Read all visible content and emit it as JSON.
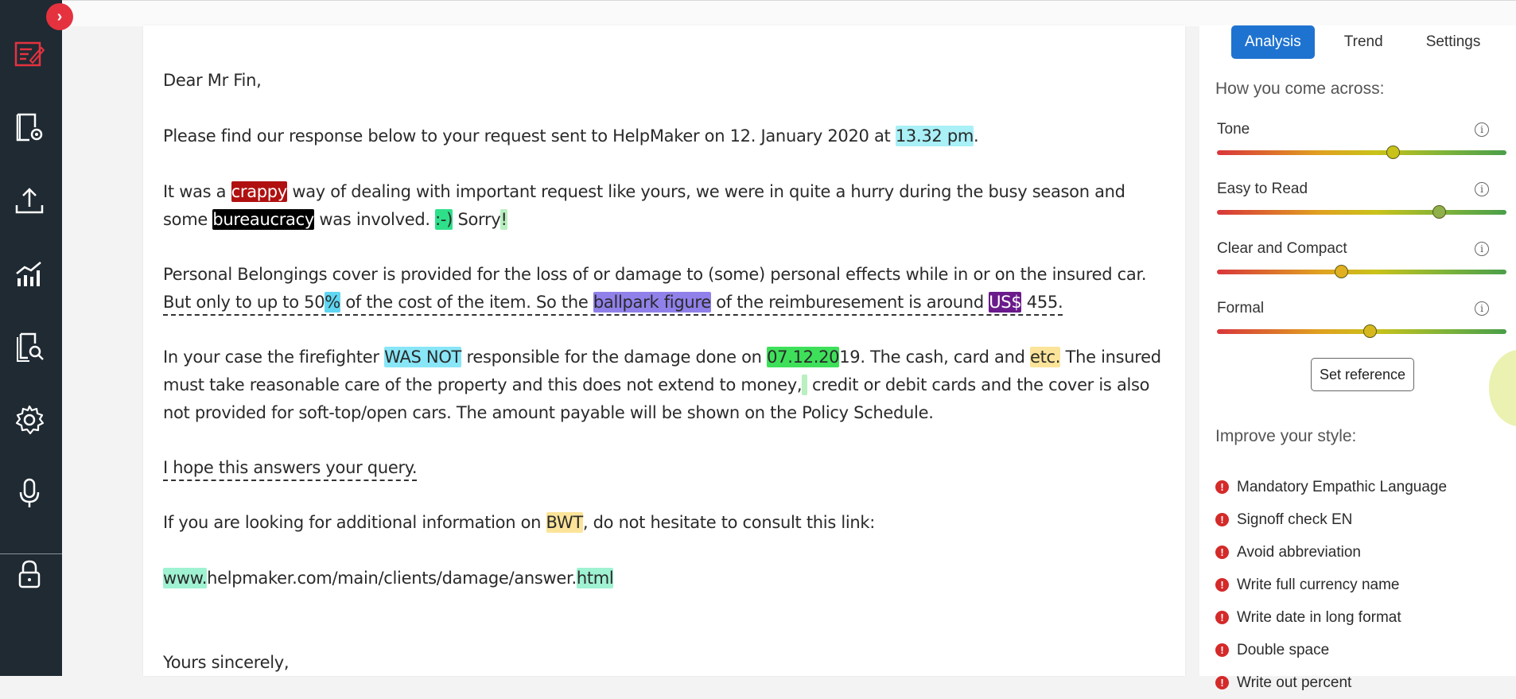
{
  "colors": {
    "rail_bg": "#1f2a33",
    "accent_red": "#e5323f",
    "tab_active": "#1f73d0",
    "hl_cyan": "#a9f0f7",
    "hl_darkred": "#b01010",
    "hl_black": "#000000",
    "hl_mint": "#2ee08a",
    "hl_lightgreen": "#b9f0c0",
    "hl_blue": "#5fd6f2",
    "hl_purple": "#9080ea",
    "hl_darkpurple": "#6a1a8a",
    "hl_skyblue": "#88e6f7",
    "hl_green": "#3ee05a",
    "hl_yellow": "#fbe49a",
    "hl_aqua": "#9ff2d2"
  },
  "nav": [
    {
      "name": "editor-icon"
    },
    {
      "name": "document-settings-icon"
    },
    {
      "name": "upload-icon"
    },
    {
      "name": "analytics-icon"
    },
    {
      "name": "document-search-icon"
    },
    {
      "name": "settings-gear-icon"
    },
    {
      "name": "microphone-icon"
    },
    {
      "name": "lock-icon"
    }
  ],
  "collapse": {
    "glyph": "›"
  },
  "letter": {
    "greeting": "Dear Mr Fin,",
    "p1": {
      "a": "Please find our response below to your request sent to HelpMaker on 12. January 2020 at ",
      "hl": "13.32 pm",
      "b": "."
    },
    "p2": {
      "a": "It was a ",
      "h1": "crappy",
      "b": " way of dealing with important request like yours, we were in quite a hurry during the busy season and some ",
      "h2": "bureaucracy",
      "c": " was involved. ",
      "h3": ":-)",
      "d": " Sorry",
      "h4": "!"
    },
    "p3": {
      "a": "Personal Belongings cover is provided for the loss of or damage to (some) personal effects while in or on the insured car. ",
      "u1": "But only to up to 50",
      "h1": "%",
      "u2": " of the cost of the item. So the ",
      "h2": "ballpark figure",
      "u3": " of the reimburesement is around ",
      "h3": "US$",
      "u4": " 455."
    },
    "p4": {
      "a": "In your case the firefighter ",
      "h1": "WAS NOT",
      "b": " responsible for the damage done on ",
      "h2": "07.12.20",
      "c": "19. The cash, card and ",
      "h3": "etc.",
      "d": " The insured must take reasonable care of the property and this does not extend to money,",
      "h4": " ",
      "e": " credit or debit cards and the cover is also not provided for soft-top/open cars. The amount payable will be shown on the Policy Schedule."
    },
    "p5": "I hope this answers your query.",
    "p6": {
      "a": "If you are looking for additional information on ",
      "hl": "BWT",
      "b": ", do not hesitate to consult this link:"
    },
    "p7": {
      "h1": "www.",
      "a": "helpmaker.com/main/clients/damage/answer.",
      "h2": "html"
    },
    "closing": "Yours sincerely,"
  },
  "panel": {
    "tabs": [
      "Analysis",
      "Trend",
      "Settings"
    ],
    "heading1": "How you come across:",
    "metrics": [
      {
        "label": "Tone",
        "level": 0.61,
        "knob_color": "#c9c21a"
      },
      {
        "label": "Easy to Read",
        "level": 0.77,
        "knob_color": "#8fb04a"
      },
      {
        "label": "Clear and Compact",
        "level": 0.43,
        "knob_color": "#e0b020"
      },
      {
        "label": "Formal",
        "level": 0.53,
        "knob_color": "#d6b81e"
      }
    ],
    "info_glyph": "i",
    "set_reference": "Set reference",
    "heading2": "Improve your style:",
    "issues": [
      "Mandatory Empathic Language",
      "Signoff check EN",
      "Avoid abbreviation",
      "Write full currency name",
      "Write date in long format",
      "Double space",
      "Write out percent"
    ]
  }
}
